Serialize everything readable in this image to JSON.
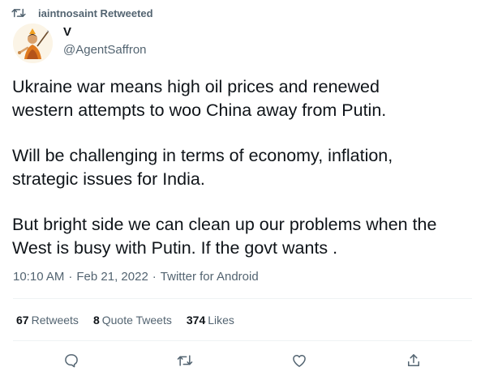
{
  "retweet": {
    "icon": "retweet-icon",
    "text": "iaintnosaint Retweeted"
  },
  "author": {
    "avatar_icon": "saffron-warrior-avatar",
    "name": "V",
    "handle": "@AgentSaffron"
  },
  "tweet": {
    "paragraphs": [
      [
        "Ukraine war means high oil prices and renewed",
        "western attempts to woo China away from Putin."
      ],
      [
        "Will be challenging in terms of economy, inflation,",
        "strategic issues for India."
      ],
      [
        "But bright side we can clean up our problems when the",
        "West is busy with Putin. If the govt wants ."
      ]
    ]
  },
  "meta": {
    "time": "10:10 AM",
    "date": "Feb 21, 2022",
    "source": "Twitter for Android",
    "separator": "·"
  },
  "stats": {
    "retweets": {
      "count": "67",
      "label": "Retweets"
    },
    "quotes": {
      "count": "8",
      "label": "Quote Tweets"
    },
    "likes": {
      "count": "374",
      "label": "Likes"
    }
  },
  "actions": [
    {
      "icon": "reply-icon"
    },
    {
      "icon": "retweet-icon"
    },
    {
      "icon": "like-icon"
    },
    {
      "icon": "share-icon"
    }
  ],
  "colors": {
    "text": "#0f1419",
    "secondary": "#536471",
    "divider": "#eff3f4"
  }
}
